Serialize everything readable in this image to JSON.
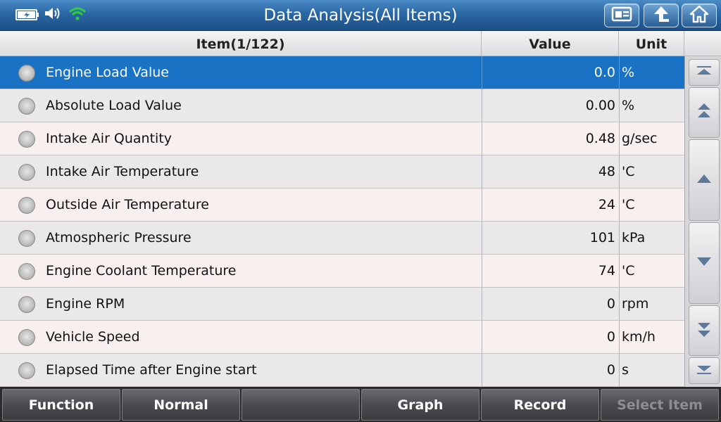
{
  "window": {
    "title": "Data Analysis(All Items)"
  },
  "toolbar_icons": [
    "battery-charging-icon",
    "speaker-icon",
    "wifi-icon",
    "id-card-icon",
    "back-arrow-icon",
    "home-icon"
  ],
  "table": {
    "headers": {
      "item": "Item(1/122)",
      "value": "Value",
      "unit": "Unit"
    },
    "rows": [
      {
        "name": "Engine Load Value",
        "value": "0.0",
        "unit": "%",
        "selected": true
      },
      {
        "name": "Absolute Load Value",
        "value": "0.00",
        "unit": "%"
      },
      {
        "name": "Intake Air Quantity",
        "value": "0.48",
        "unit": "g/sec"
      },
      {
        "name": "Intake Air Temperature",
        "value": "48",
        "unit": "'C"
      },
      {
        "name": "Outside Air Temperature",
        "value": "24",
        "unit": "'C"
      },
      {
        "name": "Atmospheric Pressure",
        "value": "101",
        "unit": "kPa"
      },
      {
        "name": "Engine Coolant Temperature",
        "value": "74",
        "unit": "'C"
      },
      {
        "name": "Engine RPM",
        "value": "0",
        "unit": "rpm"
      },
      {
        "name": "Vehicle Speed",
        "value": "0",
        "unit": "km/h"
      },
      {
        "name": "Elapsed Time after Engine start",
        "value": "0",
        "unit": "s"
      }
    ]
  },
  "scroll_buttons": [
    "scroll-top-icon",
    "page-up-icon",
    "line-up-icon",
    "line-down-icon",
    "page-down-icon",
    "scroll-bottom-icon"
  ],
  "bottom_bar": {
    "buttons": [
      {
        "label": "Function",
        "enabled": true
      },
      {
        "label": "Normal",
        "enabled": true
      },
      {
        "label": "",
        "enabled": true
      },
      {
        "label": "Graph",
        "enabled": true
      },
      {
        "label": "Record",
        "enabled": true
      },
      {
        "label": "Select Item",
        "enabled": false
      }
    ]
  },
  "colors": {
    "titlebar": "#2c6aa8",
    "selected_row": "#1a72c4",
    "wifi": "#2ecc40"
  }
}
